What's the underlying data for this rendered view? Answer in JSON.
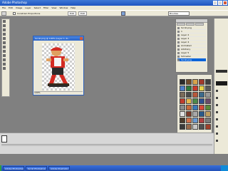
{
  "window": {
    "title": "Adobe Photoshop",
    "menu": [
      "File",
      "Edit",
      "Image",
      "Layer",
      "Select",
      "Filter",
      "View",
      "Window",
      "Help"
    ]
  },
  "options_bar": {
    "checkbox_label": "Constrain Proportions",
    "btn_a": "Edit",
    "btn_b": "Edit",
    "brush_field": "Brushes"
  },
  "document": {
    "title": "Scroll.png @ 100% (Layer 1, R...",
    "status": "100%"
  },
  "layers_palette": {
    "rows": [
      "Scroll.png",
      "1",
      "Layer 2",
      "Layer 3",
      "Layer 4",
      "Animated",
      "Arbitrary",
      "Layer 5",
      "Schneller",
      "Scroll.png"
    ],
    "selected_index": 9
  },
  "colors": {
    "swatches": [
      "#2b2b2b",
      "#6f4a2a",
      "#d8a34a",
      "#a13a2c",
      "#3f3f3f",
      "#4d7ec8",
      "#2d7a3c",
      "#c93a2c",
      "#e6d24a",
      "#5a5a5a",
      "#7a6a5a",
      "#4a4a4a",
      "#b9583b",
      "#3c6a8c",
      "#9a9a9a",
      "#bf3d2d",
      "#e5b64c",
      "#4c8a4a",
      "#2f4f8f",
      "#6a4a6a",
      "#8a8a8a",
      "#c86a3a",
      "#3a7ab8",
      "#d74a3a",
      "#5a8a3a",
      "#e0e0e0",
      "#7a3a2a",
      "#a8a8a8",
      "#2a5a8a",
      "#c0a060",
      "#4a3a2a",
      "#d0704a",
      "#6a9ad0",
      "#b04040",
      "#7a7a7a",
      "#3a3a3a",
      "#9a6a4a",
      "#c8c8c8",
      "#505050",
      "#a0402a"
    ]
  },
  "taskbar": {
    "items": [
      "Adobe Photoshop - Scroll",
      "Scroll Photoshop",
      "Adobe Illustrator"
    ]
  }
}
